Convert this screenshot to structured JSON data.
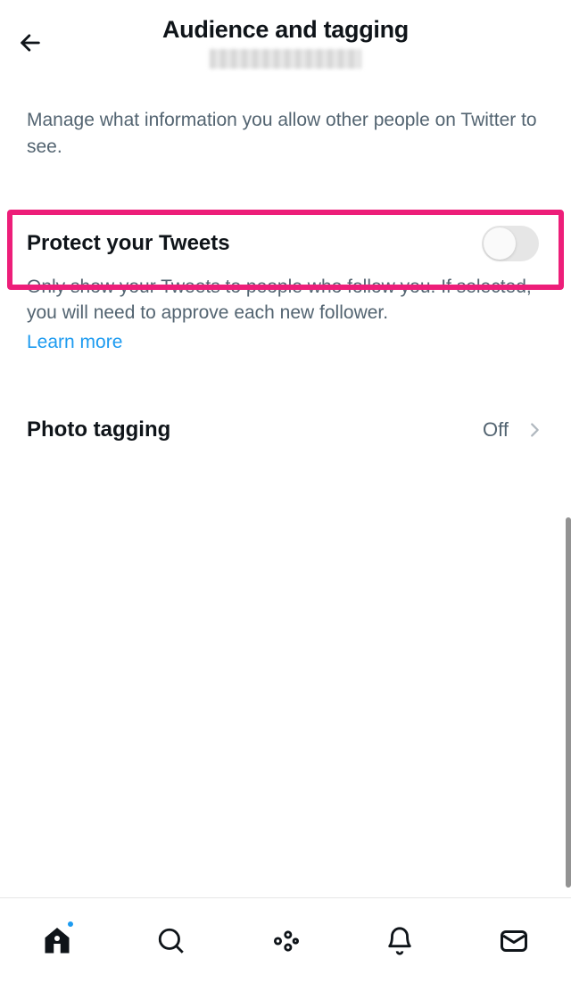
{
  "header": {
    "title": "Audience and tagging"
  },
  "description": "Manage what information you allow other people on Twitter to see.",
  "protect": {
    "title": "Protect your Tweets",
    "description": "Only show your Tweets to people who follow you. If selected, you will need to approve each new follower.",
    "learn_more": "Learn more",
    "enabled": false
  },
  "photo_tagging": {
    "title": "Photo tagging",
    "value": "Off"
  }
}
